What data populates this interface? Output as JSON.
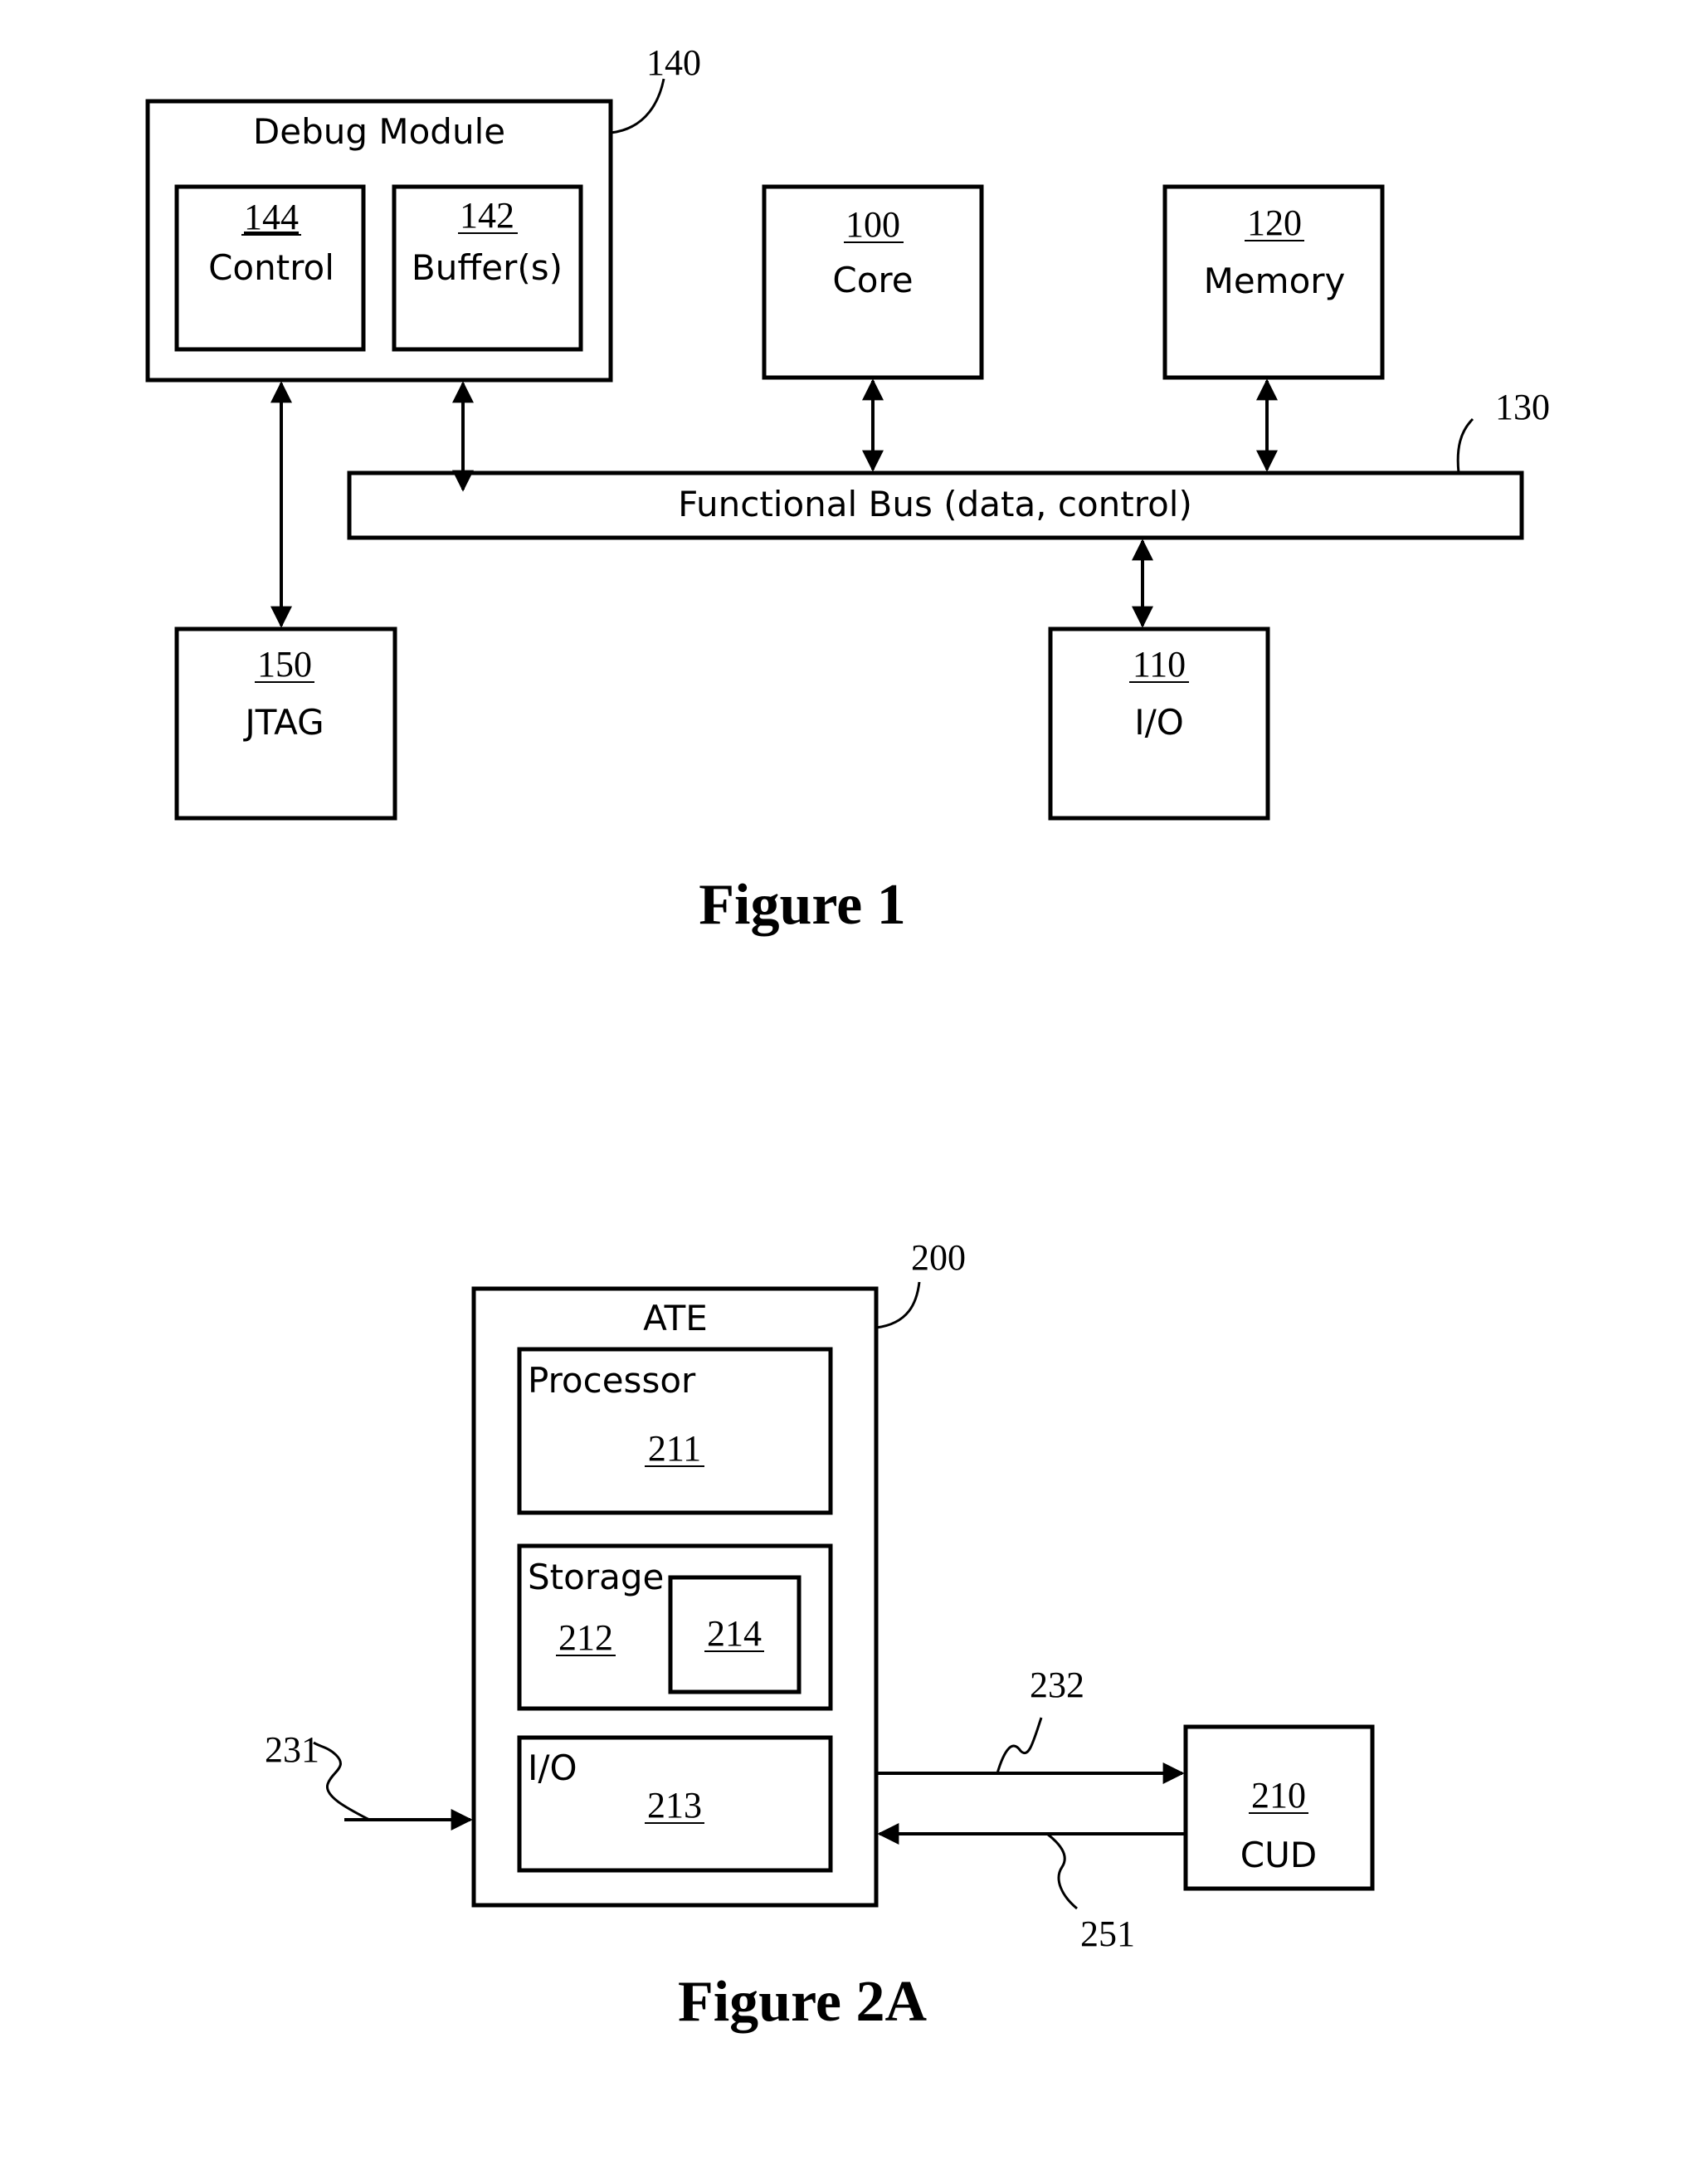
{
  "figure1": {
    "caption": "Figure 1",
    "debug_module": {
      "ref": "140",
      "label": "Debug Module"
    },
    "control": {
      "ref": "144",
      "label": "Control"
    },
    "buffers": {
      "ref": "142",
      "label": "Buffer(s)"
    },
    "core": {
      "ref": "100",
      "label": "Core"
    },
    "memory": {
      "ref": "120",
      "label": "Memory"
    },
    "bus": {
      "ref": "130",
      "label": "Functional Bus (data, control)"
    },
    "jtag": {
      "ref": "150",
      "label": "JTAG"
    },
    "io": {
      "ref": "110",
      "label": "I/O"
    }
  },
  "figure2a": {
    "caption": "Figure 2A",
    "ate": {
      "ref": "200",
      "label": "ATE"
    },
    "processor": {
      "ref": "211",
      "label": "Processor"
    },
    "storage": {
      "ref": "212",
      "label": "Storage"
    },
    "storage_inner": {
      "ref": "214"
    },
    "io": {
      "ref": "213",
      "label": "I/O"
    },
    "cud": {
      "ref": "210",
      "label": "CUD"
    },
    "signals": {
      "input": "231",
      "out": "232",
      "back": "251"
    }
  }
}
